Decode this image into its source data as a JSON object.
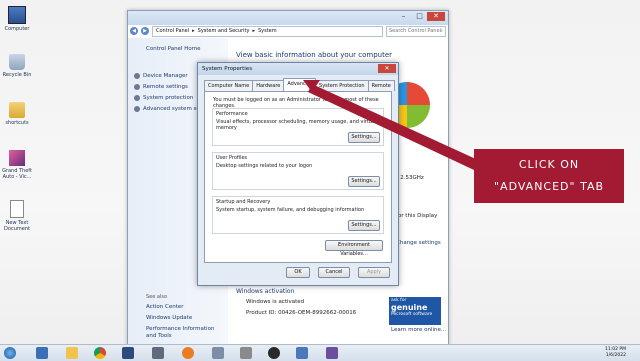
{
  "desktop": {
    "icons": [
      {
        "label": "Computer"
      },
      {
        "label": "Recycle Bin"
      },
      {
        "label": "shortcuts"
      },
      {
        "label": "Grand Theft Auto - Vic..."
      },
      {
        "label": "New Text Document"
      }
    ]
  },
  "control_panel": {
    "breadcrumb": [
      "Control Panel",
      "System and Security",
      "System"
    ],
    "search_placeholder": "Search Control Panel",
    "left": {
      "home": "Control Panel Home",
      "links": [
        "Device Manager",
        "Remote settings",
        "System protection",
        "Advanced system settings"
      ],
      "see_also_heading": "See also",
      "see_also": [
        "Action Center",
        "Windows Update",
        "Performance Information and Tools"
      ]
    },
    "heading": "View basic information about your computer",
    "right_fragments": {
      "cpu": "@ 2.53GHz",
      "touch": "for this Display",
      "change": "Change settings"
    },
    "activation": {
      "heading": "Windows activation",
      "status": "Windows is activated",
      "product_id": "Product ID: 00426-OEM-8992662-00016",
      "learn_more": "Learn more online...",
      "genuine_top": "ask for",
      "genuine_big": "genuine",
      "genuine_sub": "Microsoft software"
    }
  },
  "dialog": {
    "title": "System Properties",
    "tabs": [
      "Computer Name",
      "Hardware",
      "Advanced",
      "System Protection",
      "Remote"
    ],
    "active_tab": "Advanced",
    "admin_note": "You must be logged on as an Administrator to make most of these changes.",
    "groups": [
      {
        "title": "Performance",
        "desc": "Visual effects, processor scheduling, memory usage, and virtual memory",
        "button": "Settings..."
      },
      {
        "title": "User Profiles",
        "desc": "Desktop settings related to your logon",
        "button": "Settings..."
      },
      {
        "title": "Startup and Recovery",
        "desc": "System startup, system failure, and debugging information",
        "button": "Settings..."
      }
    ],
    "env_button": "Environment Variables...",
    "ok": "OK",
    "cancel": "Cancel",
    "apply": "Apply"
  },
  "annotation": {
    "line1": "CLICK ON",
    "line2": "\"ADVANCED\" TAB",
    "color": "#a31b32"
  },
  "taskbar": {
    "time": "11:02 PM",
    "date": "1/6/2022"
  }
}
